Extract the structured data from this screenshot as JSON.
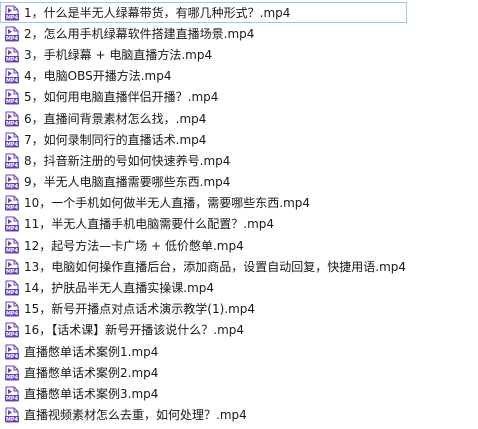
{
  "file_icon": {
    "name": "mp4-video-file-icon",
    "badge_text": "MP4",
    "color": "#6a3fb5"
  },
  "files": [
    {
      "name": "1，什么是半无人绿幕带货，有哪几种形式？.mp4",
      "selected": true
    },
    {
      "name": "2，怎么用手机绿幕软件搭建直播场景.mp4",
      "selected": false
    },
    {
      "name": "3，手机绿幕 + 电脑直播方法.mp4",
      "selected": false
    },
    {
      "name": "4，电脑OBS开播方法.mp4",
      "selected": false
    },
    {
      "name": "5，如何用电脑直播伴侣开播？.mp4",
      "selected": false
    },
    {
      "name": "6，直播间背景素材怎么找，.mp4",
      "selected": false
    },
    {
      "name": "7，如何录制同行的直播话术.mp4",
      "selected": false
    },
    {
      "name": "8，抖音新注册的号如何快速养号.mp4",
      "selected": false
    },
    {
      "name": "9，半无人电脑直播需要哪些东西.mp4",
      "selected": false
    },
    {
      "name": "10，一个手机如何做半无人直播，需要哪些东西.mp4",
      "selected": false
    },
    {
      "name": "11，半无人直播手机电脑需要什么配置？.mp4",
      "selected": false
    },
    {
      "name": "12，起号方法—卡广场 + 低价憋单.mp4",
      "selected": false
    },
    {
      "name": "13，电脑如何操作直播后台，添加商品，设置自动回复，快捷用语.mp4",
      "selected": false
    },
    {
      "name": "14，护肤品半无人直播实操课.mp4",
      "selected": false
    },
    {
      "name": "15，新号开播点对点话术演示教学(1).mp4",
      "selected": false
    },
    {
      "name": "16，【话术课】新号开播该说什么？.mp4",
      "selected": false
    },
    {
      "name": "直播憋单话术案例1.mp4",
      "selected": false
    },
    {
      "name": "直播憋单话术案例2.mp4",
      "selected": false
    },
    {
      "name": "直播憋单话术案例3.mp4",
      "selected": false
    },
    {
      "name": "直播视频素材怎么去重，如何处理？.mp4",
      "selected": false
    }
  ]
}
